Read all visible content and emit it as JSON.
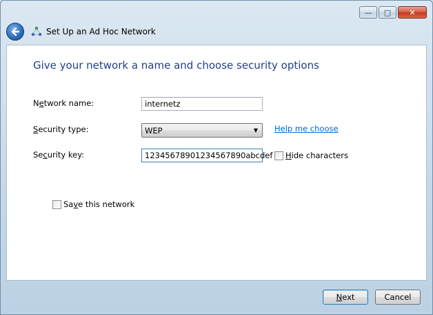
{
  "window": {
    "minimize_glyph": "—",
    "maximize_glyph": "□",
    "close_glyph": "✕"
  },
  "header": {
    "title": "Set Up an Ad Hoc Network",
    "back_icon": "back-arrow-icon",
    "wizard_icon": "ad-hoc-network-icon"
  },
  "main": {
    "heading": "Give your network a name and choose security options",
    "network_name": {
      "label_pre": "N",
      "label_ul": "e",
      "label_post": "twork name:",
      "value": "internetz"
    },
    "security_type": {
      "label_pre": "",
      "label_ul": "S",
      "label_post": "ecurity type:",
      "selected": "WEP",
      "help_link": "Help me choose"
    },
    "security_key": {
      "label_pre": "Se",
      "label_ul": "c",
      "label_post": "urity key:",
      "value": "12345678901234567890abcdef"
    },
    "hide_characters": {
      "label_pre": "",
      "label_ul": "H",
      "label_post": "ide characters",
      "checked": false
    },
    "save_network": {
      "label_pre": "Sa",
      "label_ul": "v",
      "label_post": "e this network",
      "checked": false
    }
  },
  "footer": {
    "next_pre": "",
    "next_ul": "N",
    "next_post": "ext",
    "cancel": "Cancel"
  },
  "colors": {
    "heading": "#1e3f8f",
    "link": "#0066cc",
    "close_button": "#c0391f"
  }
}
